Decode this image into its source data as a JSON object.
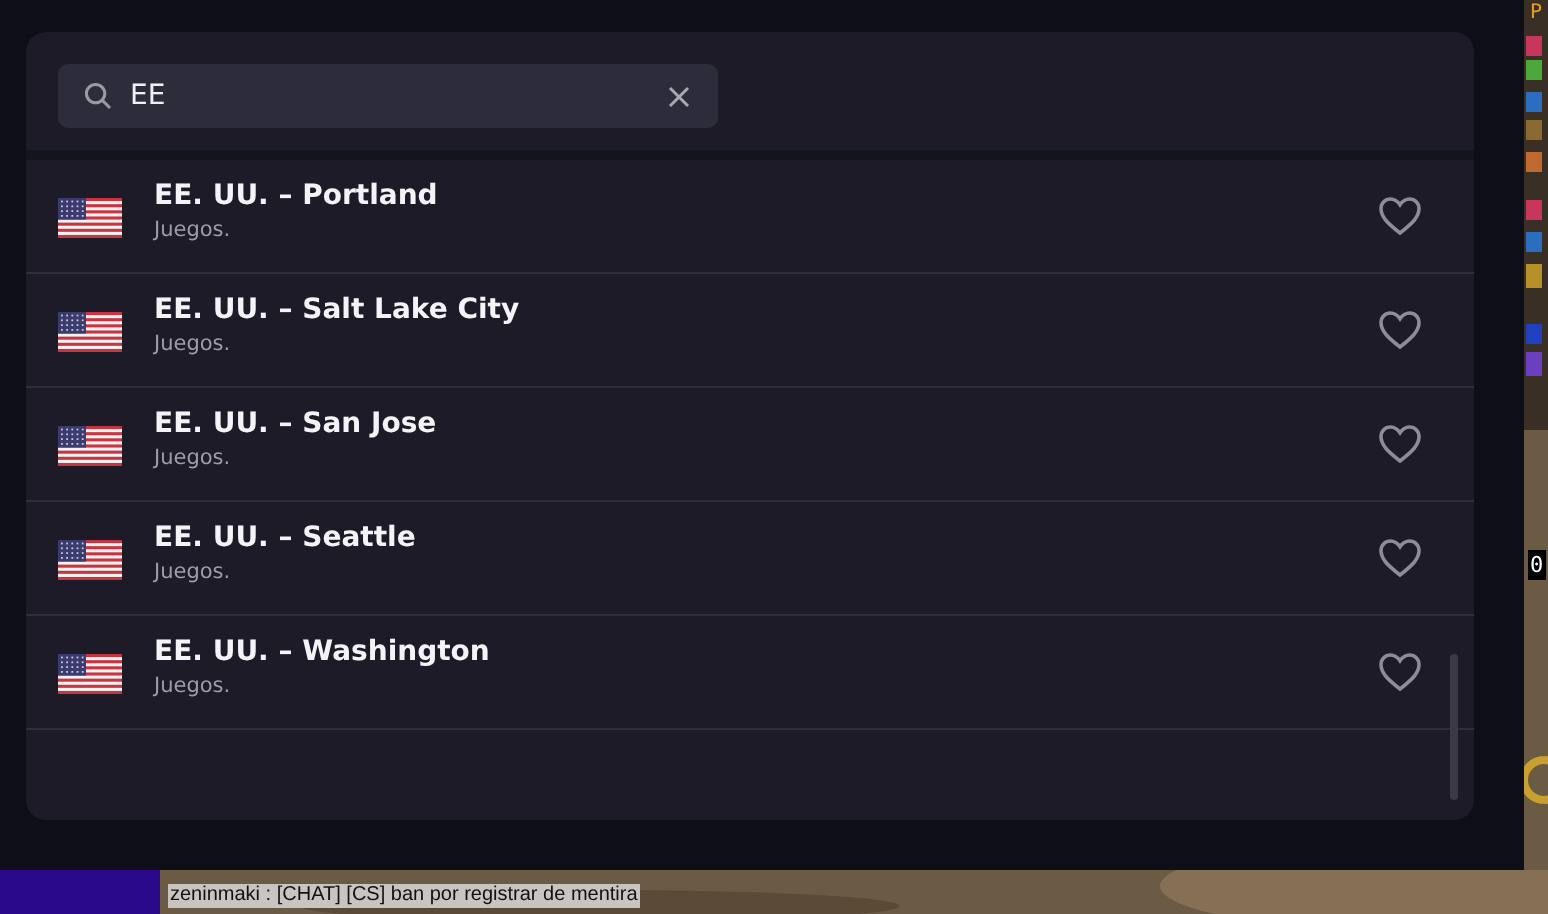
{
  "search": {
    "value": "EE"
  },
  "results": [
    {
      "title": "EE. UU. – Portland",
      "subtitle": "Juegos.",
      "favorite": false
    },
    {
      "title": "EE. UU. – Salt Lake City",
      "subtitle": "Juegos.",
      "favorite": false
    },
    {
      "title": "EE. UU. – San Jose",
      "subtitle": "Juegos.",
      "favorite": false
    },
    {
      "title": "EE. UU. – Seattle",
      "subtitle": "Juegos.",
      "favorite": false
    },
    {
      "title": "EE. UU. – Washington",
      "subtitle": "Juegos.",
      "favorite": false
    }
  ],
  "game": {
    "top_label": "P",
    "counter": "0",
    "chat_lines": [
      "zeninmaki : [CHAT] [CS] ban por registrar de mentira"
    ]
  }
}
